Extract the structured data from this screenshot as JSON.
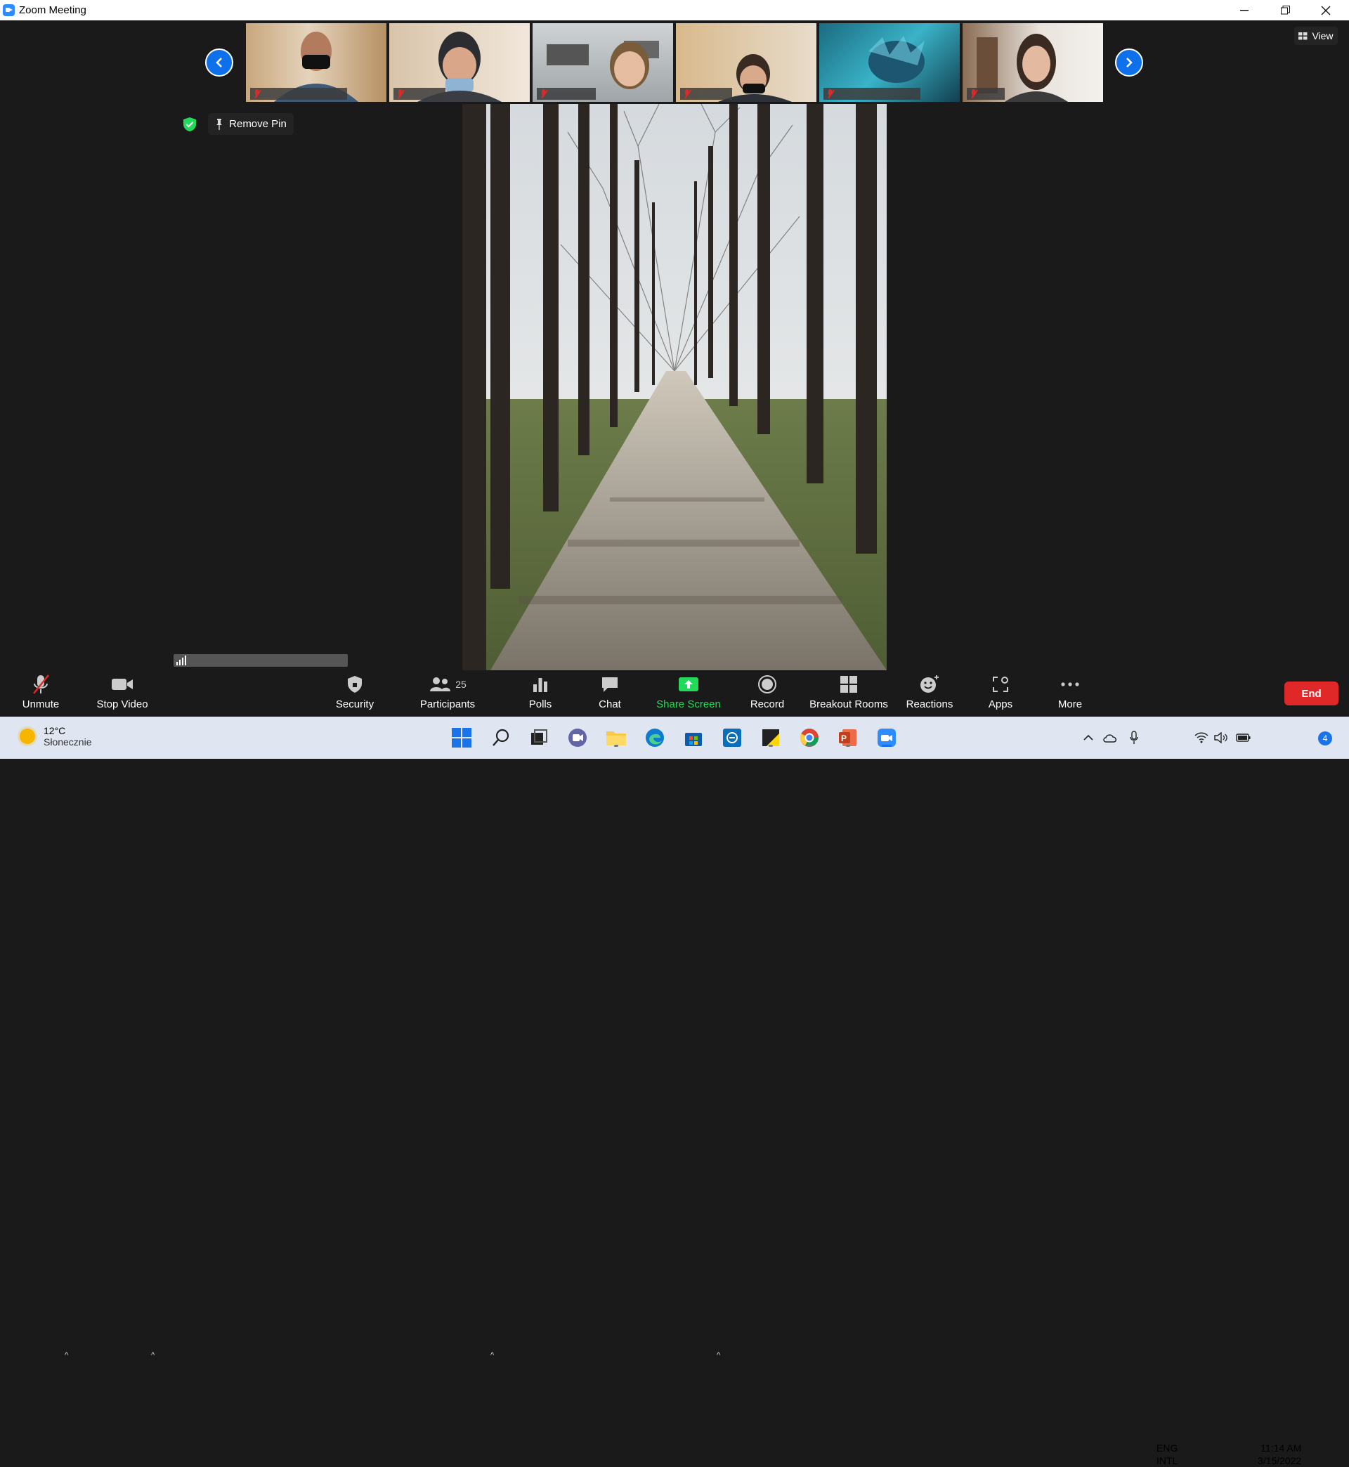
{
  "window": {
    "title": "Zoom Meeting"
  },
  "strip": {
    "participants": [
      {
        "name": "participant-1"
      },
      {
        "name": "participant-2"
      },
      {
        "name": "participant-3"
      },
      {
        "name": "participant-4"
      },
      {
        "name": "participant-5"
      },
      {
        "name": "participant-6"
      }
    ],
    "view_label": "View"
  },
  "pin": {
    "remove_pin_label": "Remove Pin"
  },
  "toolbar": {
    "unmute": "Unmute",
    "stop_video": "Stop Video",
    "security": "Security",
    "participants": "Participants",
    "participants_count": "25",
    "polls": "Polls",
    "chat": "Chat",
    "share_screen": "Share Screen",
    "record": "Record",
    "breakout_rooms": "Breakout Rooms",
    "reactions": "Reactions",
    "apps": "Apps",
    "more": "More",
    "end": "End"
  },
  "colors": {
    "accent_blue": "#0e71eb",
    "share_green": "#23d959",
    "end_red": "#e02828",
    "toolbar_bg": "#1a1a1a"
  },
  "taskbar": {
    "weather_temp": "12°C",
    "weather_desc": "Słonecznie",
    "lang_top": "ENG",
    "lang_bottom": "INTL",
    "time": "11:14 AM",
    "date": "3/15/2022",
    "notifications": "4"
  }
}
